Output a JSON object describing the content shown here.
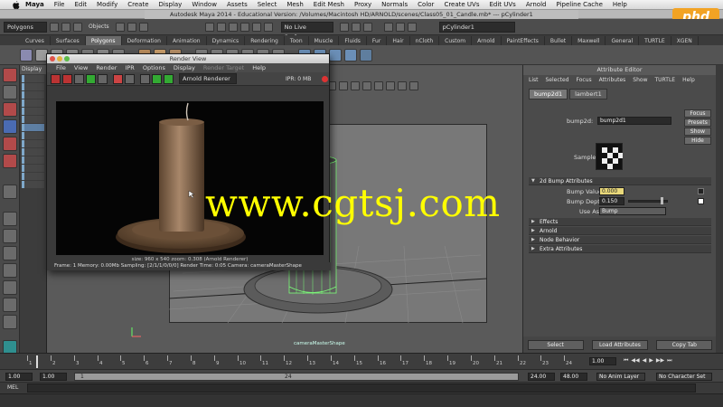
{
  "menubar": {
    "items": [
      "Maya",
      "File",
      "Edit",
      "Modify",
      "Create",
      "Display",
      "Window",
      "Assets",
      "Select",
      "Mesh",
      "Edit Mesh",
      "Proxy",
      "Normals",
      "Color",
      "Create UVs",
      "Edit UVs",
      "Arnold",
      "Pipeline Cache",
      "Help"
    ]
  },
  "window": {
    "title": "Autodesk Maya 2014 - Educational Version: /Volumes/Macintosh HD/ARNOLD/scenes/Class05_01_Candle.mb* --- pCylinder1"
  },
  "statusline": {
    "mode": "Polygons",
    "objects_label": "Objects",
    "live_surface": "No Live Surface",
    "selected_object": "pCylinder1"
  },
  "shelf_tabs": [
    "Curves",
    "Surfaces",
    "Polygons",
    "Deformation",
    "Animation",
    "Dynamics",
    "Rendering",
    "Toon",
    "Muscle",
    "Fluids",
    "Fur",
    "Hair",
    "nCloth",
    "Custom",
    "Arnold",
    "PaintEffects",
    "Bullet",
    "Maxwell",
    "General",
    "TURTLE",
    "XGEN"
  ],
  "shelf_active": "Polygons",
  "render_view": {
    "title": "Render View",
    "menu": [
      "File",
      "View",
      "Render",
      "IPR",
      "Options",
      "Display",
      "Render Target",
      "Help"
    ],
    "renderer": "Arnold Renderer",
    "ipr_status": "IPR: 0 MB",
    "image_status": "size: 960 x 540  zoom: 0.308     (Arnold Renderer)",
    "footer": "Frame: 1     Memory: 0.00Mb     Sampling: [2/1/1/0/0/0]     Render Time: 0:05     Camera: cameraMasterShape"
  },
  "outliner": {
    "title": "Display"
  },
  "viewport": {
    "camera_label": "cameraMasterShape"
  },
  "attribute_editor": {
    "title": "Attribute Editor",
    "menu": [
      "List",
      "Selected",
      "Focus",
      "Attributes",
      "Show",
      "TURTLE",
      "Help"
    ],
    "tabs": [
      "bump2d1",
      "lambert1"
    ],
    "node_label": "bump2d:",
    "node_value": "bump2d1",
    "focus_button": "Focus",
    "presets_button": "Presets",
    "show_button": "Show",
    "hide_button": "Hide",
    "sample_label": "Sample",
    "section_bump": "2d Bump Attributes",
    "bump_value_label": "Bump Value",
    "bump_value": "0.000",
    "bump_depth_label": "Bump Depth",
    "bump_depth": "0.150",
    "use_as_label": "Use As:",
    "use_as_value": "Bump",
    "sections": [
      "Effects",
      "Arnold",
      "Node Behavior",
      "Extra Attributes"
    ],
    "select_button": "Select",
    "load_attributes_button": "Load Attributes",
    "copy_tab_button": "Copy Tab"
  },
  "timeline": {
    "current_frame": "1.00",
    "ticks": [
      "1",
      "2",
      "3",
      "4",
      "5",
      "6",
      "7",
      "8",
      "9",
      "10",
      "11",
      "12",
      "13",
      "14",
      "15",
      "16",
      "17",
      "18",
      "19",
      "20",
      "21",
      "22",
      "23",
      "24"
    ],
    "range_start": "1.00",
    "range_start_b": "1.00",
    "range_marker": "1",
    "range_end_marker": "24",
    "range_end": "24.00",
    "range_end_b": "48.00",
    "anim_layer": "No Anim Layer",
    "character_set": "No Character Set"
  },
  "cmdline": {
    "label": "MEL"
  },
  "watermark": {
    "text": "www.cgtsj.com"
  },
  "logo": {
    "text": "phd"
  },
  "colors": {
    "accent_yellow": "#ffff00",
    "viewport_grey": "#787878",
    "wire_green": "#7dff7a"
  }
}
